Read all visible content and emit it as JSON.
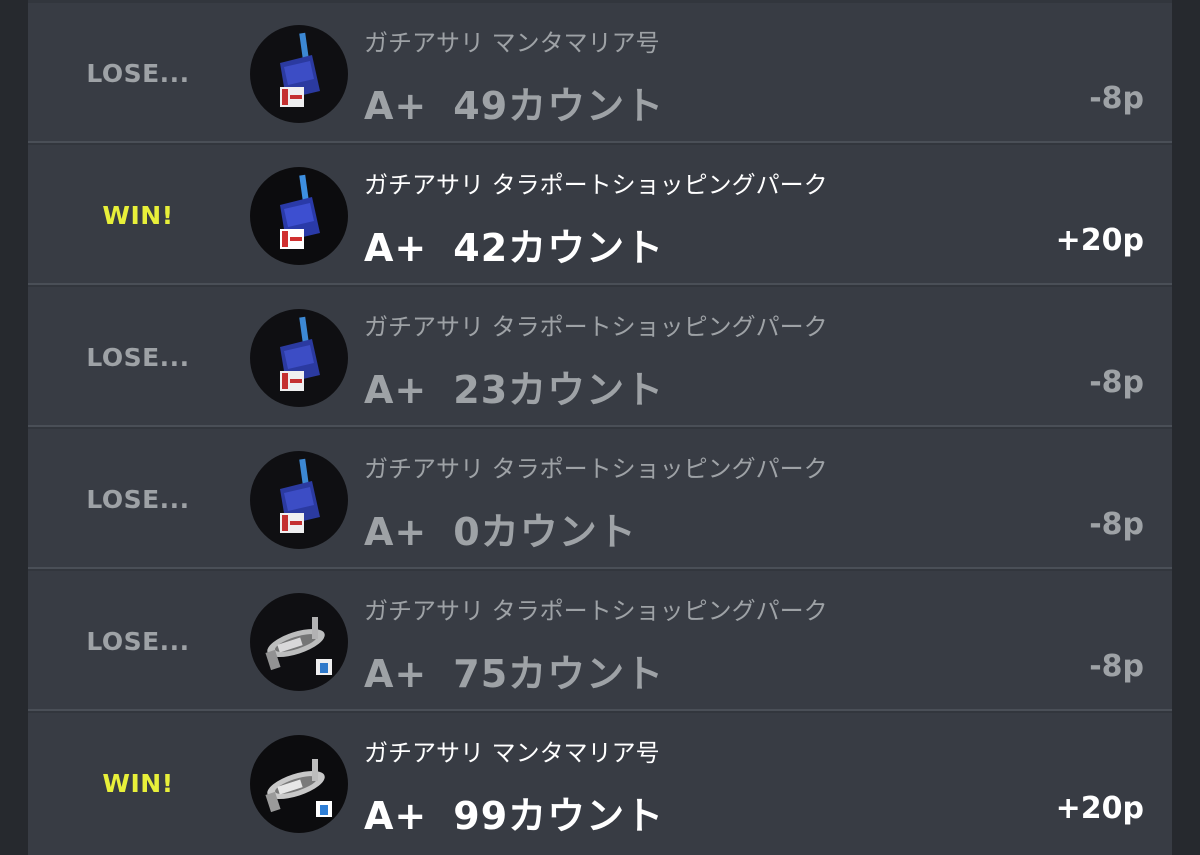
{
  "battles": [
    {
      "result": "LOSE...",
      "outcome": "lose",
      "weapon_icon": "weapon-blue-icon",
      "mode": "ガチアサリ",
      "stage": "マンタマリア号",
      "rank": "A+",
      "count": "49カウント",
      "points": "-8p"
    },
    {
      "result": "WIN!",
      "outcome": "win",
      "weapon_icon": "weapon-blue-icon",
      "mode": "ガチアサリ",
      "stage": "タラポートショッピングパーク",
      "rank": "A+",
      "count": "42カウント",
      "points": "+20p"
    },
    {
      "result": "LOSE...",
      "outcome": "lose",
      "weapon_icon": "weapon-blue-icon",
      "mode": "ガチアサリ",
      "stage": "タラポートショッピングパーク",
      "rank": "A+",
      "count": "23カウント",
      "points": "-8p"
    },
    {
      "result": "LOSE...",
      "outcome": "lose",
      "weapon_icon": "weapon-blue-icon",
      "mode": "ガチアサリ",
      "stage": "タラポートショッピングパーク",
      "rank": "A+",
      "count": "0カウント",
      "points": "-8p"
    },
    {
      "result": "LOSE...",
      "outcome": "lose",
      "weapon_icon": "weapon-gray-icon",
      "mode": "ガチアサリ",
      "stage": "タラポートショッピングパーク",
      "rank": "A+",
      "count": "75カウント",
      "points": "-8p"
    },
    {
      "result": "WIN!",
      "outcome": "win",
      "weapon_icon": "weapon-gray-icon",
      "mode": "ガチアサリ",
      "stage": "マンタマリア号",
      "rank": "A+",
      "count": "99カウント",
      "points": "+20p"
    }
  ],
  "colors": {
    "background": "#26292e",
    "row": "#383c44",
    "win": "#e8f03a",
    "lose": "#9ea2a6"
  }
}
